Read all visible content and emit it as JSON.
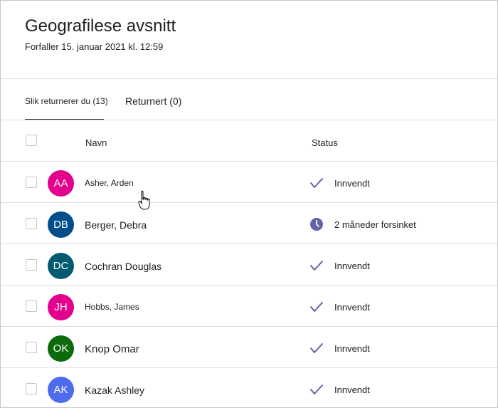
{
  "assignment": {
    "title": "Geografilese avsnitt",
    "due": "Forfaller 15. januar 2021 kl. 12:59"
  },
  "tabs": [
    {
      "label": "Slik returnerer du (13)",
      "active": true
    },
    {
      "label": "Returnert (0)",
      "active": false
    }
  ],
  "columns": {
    "name": "Navn",
    "status": "Status"
  },
  "students": [
    {
      "initials": "AA",
      "name": "Asher, Arden",
      "status": "Innvendt",
      "status_icon": "check-icon",
      "avatar_color": "#e3008c"
    },
    {
      "initials": "DB",
      "name": "Berger, Debra",
      "status": "2 måneder forsinket",
      "status_icon": "clock-icon",
      "avatar_color": "#004e8c"
    },
    {
      "initials": "DC",
      "name": "Cochran Douglas",
      "status": "Innvendt",
      "status_icon": "check-icon",
      "avatar_color": "#005b70"
    },
    {
      "initials": "JH",
      "name": "Hobbs, James",
      "status": "Innvendt",
      "status_icon": "check-icon",
      "avatar_color": "#e3008c"
    },
    {
      "initials": "OK",
      "name": "Knop Omar",
      "status": "Innvendt",
      "status_icon": "check-icon",
      "avatar_color": "#0b6a0b"
    },
    {
      "initials": "AK",
      "name": "Kazak Ashley",
      "status": "Innvendt",
      "status_icon": "check-icon",
      "avatar_color": "#4f6bed"
    }
  ],
  "colors": {
    "accent": "#6264a7",
    "divider": "#e1dfdd"
  }
}
